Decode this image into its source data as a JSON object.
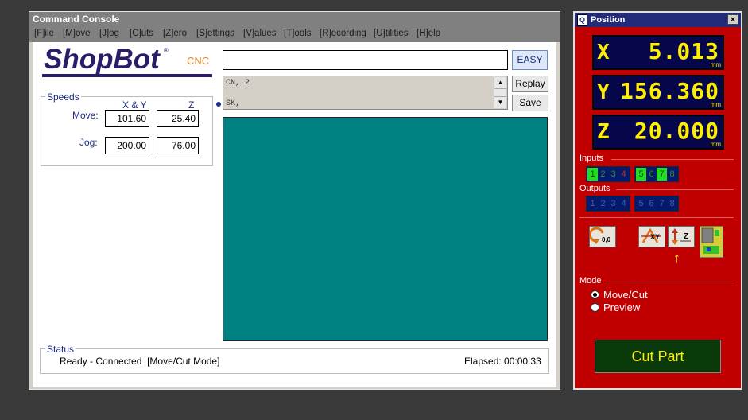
{
  "console": {
    "title": "Command Console",
    "menu": [
      "[F]ile",
      "[M]ove",
      "[J]og",
      "[C]uts",
      "[Z]ero",
      "[S]ettings",
      "[V]alues",
      "[T]ools",
      "[R]ecording",
      "[U]tilities",
      "[H]elp"
    ],
    "logo": {
      "name": "ShopBot",
      "sub": "CNC",
      "reg": "®"
    },
    "command_input": "",
    "easy_label": "EASY",
    "history": [
      "CN, 2",
      "SK,"
    ],
    "replay_label": "Replay",
    "save_label": "Save",
    "speeds": {
      "legend": "Speeds",
      "col_xy": "X & Y",
      "col_z": "Z",
      "move_label": "Move:",
      "jog_label": "Jog:",
      "move_xy": "101.60",
      "move_z": "25.40",
      "jog_xy": "200.00",
      "jog_z": "76.00"
    },
    "status": {
      "legend": "Status",
      "text": "Ready - Connected  [Move/Cut Mode]",
      "elapsed": "Elapsed: 00:00:33"
    },
    "colors": {
      "preview": "#008080"
    }
  },
  "position": {
    "title": "Position",
    "close_label": "×",
    "readouts": [
      {
        "axis": "X",
        "value": "5.013",
        "unit": "mm"
      },
      {
        "axis": "Y",
        "value": "156.360",
        "unit": "mm"
      },
      {
        "axis": "Z",
        "value": "20.000",
        "unit": "mm"
      }
    ],
    "inputs_label": "Inputs",
    "inputs": [
      {
        "n": "1",
        "on": true
      },
      {
        "n": "2",
        "on": false
      },
      {
        "n": "3",
        "on": false
      },
      {
        "n": "4",
        "on": false
      },
      {
        "n": "5",
        "on": true
      },
      {
        "n": "6",
        "on": false
      },
      {
        "n": "7",
        "on": true
      },
      {
        "n": "8",
        "on": false
      }
    ],
    "outputs_label": "Outputs",
    "outputs": [
      "1",
      "2",
      "3",
      "4",
      "5",
      "6",
      "7",
      "8"
    ],
    "icons": [
      "goto-zero-icon",
      "zero-xy-icon",
      "zero-z-icon",
      "keypad-icon"
    ],
    "icon_text": {
      "zero": "0,0",
      "xy": "XY",
      "z": "Z"
    },
    "mode_label": "Mode",
    "modes": [
      "Move/Cut",
      "Preview"
    ],
    "selected_mode": "Move/Cut",
    "cut_part_label": "Cut Part",
    "colors": {
      "panel": "#c00000",
      "readout": "#ffee00",
      "cut_button": "#0a3a0a"
    }
  }
}
